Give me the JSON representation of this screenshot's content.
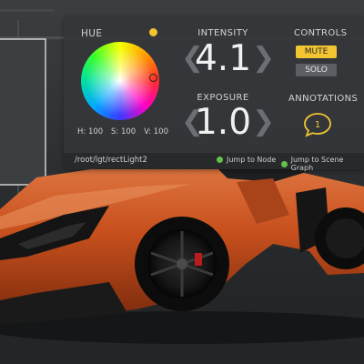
{
  "hud": {
    "hue": {
      "title": "HUE",
      "hsv": {
        "h_label": "H: 100",
        "s_label": "S: 100",
        "v_label": "V: 100"
      }
    },
    "intensity": {
      "title": "INTENSITY",
      "value": "4.1"
    },
    "exposure": {
      "title": "EXPOSURE",
      "value": "1.0"
    },
    "stepper_glyphs": {
      "decrement": "❮",
      "increment": "❯"
    },
    "controls": {
      "title": "CONTROLS",
      "mute_label": "MUTE",
      "solo_label": "SOLO",
      "mute_active": true
    },
    "annotations": {
      "title": "ANNOTATIONS",
      "count": "1"
    },
    "footer": {
      "path": "/root/lgt/rectLight2",
      "jump_node_label": "Jump to Node",
      "jump_scene_label": "Jump to Scene Graph"
    }
  },
  "colors": {
    "accent": "#f2c531",
    "panel_bg": "#343639",
    "car_body": "#c8501d",
    "jump_icon": "#62c14a"
  },
  "icons": [
    "hue-status-dot-icon",
    "speech-bubble-icon",
    "jump-node-icon",
    "jump-scene-icon"
  ]
}
